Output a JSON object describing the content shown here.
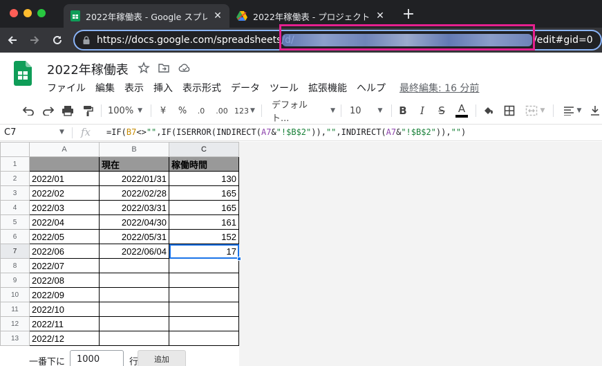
{
  "browser": {
    "tabs": [
      {
        "title": "2022年稼働表 - Google スプレッ",
        "active": true,
        "icon": "sheets-favicon"
      },
      {
        "title": "2022年稼働表 - プロジェクト編集",
        "active": false,
        "icon": "drive-favicon"
      }
    ],
    "url_visible": "https://docs.google.com/spreadsheets/d/",
    "url_tail": "/edit#gid=0"
  },
  "doc": {
    "title": "2022年稼働表",
    "menu": [
      "ファイル",
      "編集",
      "表示",
      "挿入",
      "表示形式",
      "データ",
      "ツール",
      "拡張機能",
      "ヘルプ"
    ],
    "last_edit": "最終編集: 16 分前"
  },
  "toolbar": {
    "zoom": "100%",
    "currency": "¥",
    "percent": "%",
    "dec_decrease": ".0",
    "dec_increase": ".00",
    "number_format": "123",
    "font": "デフォルト...",
    "font_size": "10",
    "bold": "B",
    "italic": "I",
    "strike": "S",
    "text_color": "A",
    "colors": {
      "text_color_bar": "#000000",
      "accent": "#1a73e8"
    }
  },
  "formula_bar": {
    "cell_ref": "C7",
    "fx": "fx",
    "parts": [
      "=IF(",
      "B7",
      "<>",
      "\"\"",
      ",IF(ISERROR(INDIRECT(",
      "A7",
      "&",
      "\"!$B$2\"",
      ")),",
      "\"\"",
      ",INDIRECT(",
      "A7",
      "&",
      "\"!$B$2\"",
      ")),",
      "\"\"",
      ")"
    ]
  },
  "grid": {
    "columns": [
      "A",
      "B",
      "C"
    ],
    "header_row": {
      "a": "",
      "b": "現在",
      "c": "稼働時間"
    },
    "rows": [
      {
        "n": "2",
        "a": "2022/01",
        "b": "2022/01/31",
        "c": "130"
      },
      {
        "n": "3",
        "a": "2022/02",
        "b": "2022/02/28",
        "c": "165"
      },
      {
        "n": "4",
        "a": "2022/03",
        "b": "2022/03/31",
        "c": "165"
      },
      {
        "n": "5",
        "a": "2022/04",
        "b": "2022/04/30",
        "c": "161"
      },
      {
        "n": "6",
        "a": "2022/05",
        "b": "2022/05/31",
        "c": "152"
      },
      {
        "n": "7",
        "a": "2022/06",
        "b": "2022/06/04",
        "c": "17"
      },
      {
        "n": "8",
        "a": "2022/07",
        "b": "",
        "c": ""
      },
      {
        "n": "9",
        "a": "2022/08",
        "b": "",
        "c": ""
      },
      {
        "n": "10",
        "a": "2022/09",
        "b": "",
        "c": ""
      },
      {
        "n": "11",
        "a": "2022/10",
        "b": "",
        "c": ""
      },
      {
        "n": "12",
        "a": "2022/11",
        "b": "",
        "c": ""
      },
      {
        "n": "13",
        "a": "2022/12",
        "b": "",
        "c": ""
      }
    ],
    "active_cell": "C7"
  },
  "add_rows": {
    "label": "一番下に",
    "value": "1000",
    "unit": "行",
    "button": "追加"
  }
}
